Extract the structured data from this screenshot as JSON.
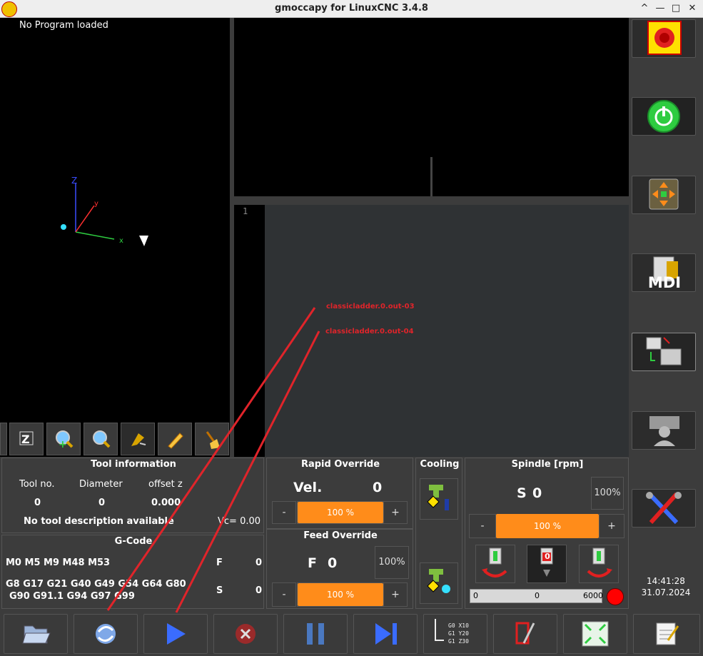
{
  "window": {
    "title": "gmoccapy for LinuxCNC  3.4.8",
    "minimize": "—",
    "maximize": "□",
    "restore": "^",
    "close": "✕"
  },
  "preview": {
    "status": "No Program loaded",
    "axis_x": "x",
    "axis_y": "y",
    "axis_z": "Z"
  },
  "editor": {
    "line_number": "1"
  },
  "annotations": {
    "label1": "classicladder.0.out-03",
    "label2": "classicladder.0.out-04",
    "color": "#e0242a"
  },
  "sidebar": {
    "mdi_label": "MDI"
  },
  "tool_info": {
    "title": "Tool information",
    "col_tool": "Tool no.",
    "col_diameter": "Diameter",
    "col_offset": "offset z",
    "tool_no": "0",
    "diameter": "0",
    "offset_z": "0.000",
    "description": "No tool description available",
    "vc": "Vc= 0.00"
  },
  "gcode": {
    "title": "G-Code",
    "mcodes": "M0 M5 M9 M48 M53",
    "gcodes_line1": "G8 G17 G21 G40 G49 G54 G64 G80",
    "gcodes_line2": "G90 G91.1 G94 G97 G99",
    "f_label": "F",
    "f_value": "0",
    "s_label": "S",
    "s_value": "0"
  },
  "rapid": {
    "title": "Rapid Override",
    "vel_label": "Vel.",
    "vel_value": "0",
    "minus": "-",
    "plus": "+",
    "percent": "100 %",
    "fraction": 1.0
  },
  "feed": {
    "title": "Feed Override",
    "f_label": "F",
    "f_value": "0",
    "reset": "100%",
    "minus": "-",
    "plus": "+",
    "percent": "100 %",
    "fraction": 1.0
  },
  "cooling": {
    "title": "Cooling"
  },
  "spindle": {
    "title": "Spindle [rpm]",
    "s_label": "S",
    "s_value": "0",
    "reset": "100%",
    "minus": "-",
    "plus": "+",
    "percent": "100 %",
    "stop_value": "0",
    "bar_min": "0",
    "bar_mid": "0",
    "bar_max": "6000"
  },
  "clock": {
    "time": "14:41:28",
    "date": "31.07.2024"
  },
  "bottom_buttons": {
    "gcode_line1": "G0  X10",
    "gcode_line2": "G1  Y20",
    "gcode_line3": "G1  Z30"
  },
  "colors": {
    "accent": "#ff8c1a",
    "background": "#3c3c3c",
    "power_green": "#2ecc40",
    "estop_yellow": "#ffe000"
  }
}
